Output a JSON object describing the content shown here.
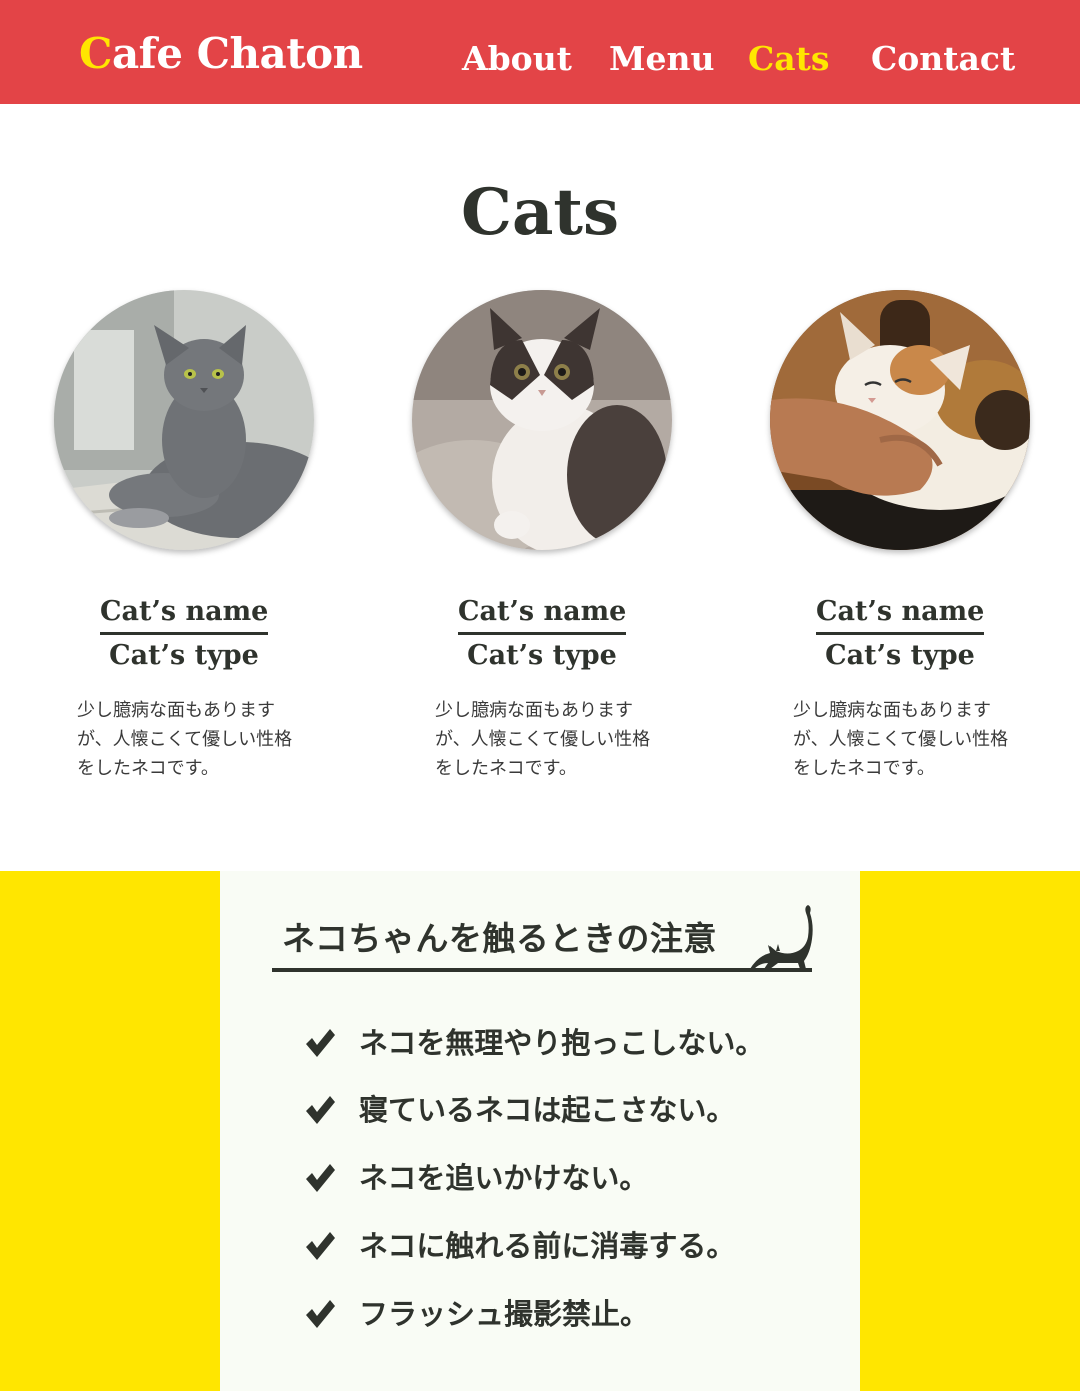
{
  "header": {
    "brand_initial": "C",
    "brand_rest": "afe Chaton",
    "nav": [
      {
        "label": "About",
        "active": false
      },
      {
        "label": "Menu",
        "active": false
      },
      {
        "label": "Cats",
        "active": true
      },
      {
        "label": "Contact",
        "active": false
      }
    ]
  },
  "colors": {
    "header_bg": "#e34447",
    "accent_yellow": "#ffe600",
    "text_dark": "#2f332d",
    "panel_bg": "#f9fcf5"
  },
  "cats_section": {
    "title": "Cats",
    "cards": [
      {
        "photo_icon": "gray-cat-photo",
        "name": "Cat’s name",
        "type": "Cat’s type",
        "description": "少し臆病な面もありますが、人懐こくて優しい性格をしたネコです。"
      },
      {
        "photo_icon": "black-white-kitten-photo",
        "name": "Cat’s name",
        "type": "Cat’s type",
        "description": "少し臆病な面もありますが、人懐こくて優しい性格をしたネコです。"
      },
      {
        "photo_icon": "calico-cat-petted-photo",
        "name": "Cat’s name",
        "type": "Cat’s type",
        "description": "少し臆病な面もありますが、人懐こくて優しい性格をしたネコです。"
      }
    ]
  },
  "notice": {
    "title": "ネコちゃんを触るときの注意",
    "title_icon": "stretching-cat-icon",
    "rule_icon": "check-icon",
    "rules": [
      "ネコを無理やり抱っこしない。",
      "寝ているネコは起こさない。",
      "ネコを追いかけない。",
      "ネコに触れる前に消毒する。",
      "フラッシュ撮影禁止。"
    ]
  }
}
